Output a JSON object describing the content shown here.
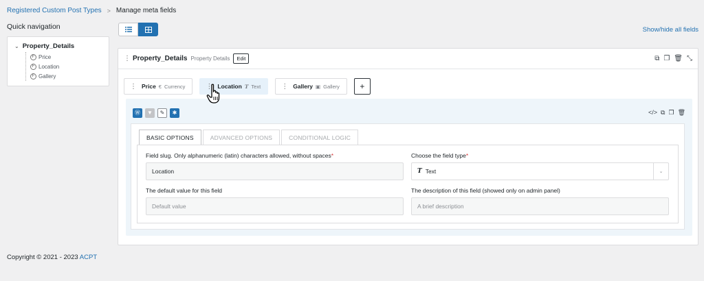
{
  "breadcrumb": {
    "root": "Registered Custom Post Types",
    "separator": ">",
    "current": "Manage meta fields"
  },
  "quick_nav": {
    "title": "Quick navigation",
    "root": "Property_Details",
    "children": [
      {
        "badge": "F",
        "label": "Price"
      },
      {
        "badge": "F",
        "label": "Location"
      },
      {
        "badge": "F",
        "label": "Gallery"
      }
    ]
  },
  "view_toggle": {
    "list_icon": "list-icon",
    "grid_icon": "grid-icon",
    "active": "grid"
  },
  "show_hide_label": "Show/hide all fields",
  "box": {
    "name": "Property_Details",
    "label": "Property Details",
    "edit_label": "Edit"
  },
  "fields": [
    {
      "name": "Price",
      "type_icon": "€",
      "type": "Currency"
    },
    {
      "name": "Location",
      "type_icon": "T",
      "type": "Text"
    },
    {
      "name": "Gallery",
      "type_icon": "▣",
      "type": "Gallery"
    }
  ],
  "add_label": "+",
  "tabs": [
    "BASIC OPTIONS",
    "ADVANCED OPTIONS",
    "CONDITIONAL LOGIC"
  ],
  "form": {
    "slug_label": "Field slug. Only alphanumeric (latin) characters allowed, without spaces",
    "slug_value": "Location",
    "type_label": "Choose the field type",
    "type_icon": "T",
    "type_value": "Text",
    "default_label": "The default value for this field",
    "default_placeholder": "Default value",
    "description_label": "The description of this field (showed only on admin panel)",
    "description_placeholder": "A brief description",
    "required_mark": "*"
  },
  "footer": {
    "text": "Copyright © 2021 - 2023",
    "link": "ACPT"
  },
  "colors": {
    "accent": "#2271b1",
    "background": "#f0f0f1",
    "required": "#d63638",
    "panel": "#eef5fa"
  }
}
